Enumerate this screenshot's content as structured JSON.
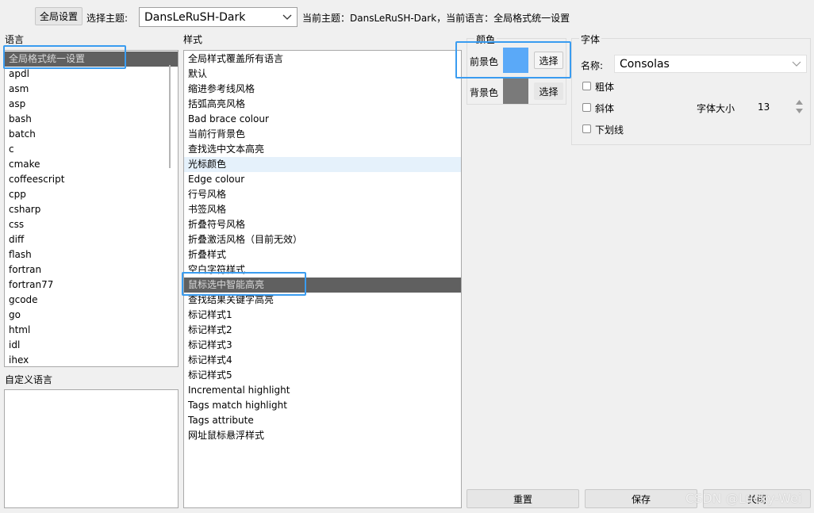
{
  "toolbar": {
    "global_settings_button": "全局设置",
    "select_theme_label": "选择主题:",
    "theme_value": "DansLeRuSH-Dark",
    "status_text": "当前主题：DansLeRuSH-Dark，当前语言：全局格式统一设置"
  },
  "language": {
    "label": "语言",
    "items": [
      "全局格式统一设置",
      "apdl",
      "asm",
      "asp",
      "bash",
      "batch",
      "c",
      "cmake",
      "coffeescript",
      "cpp",
      "csharp",
      "css",
      "diff",
      "flash",
      "fortran",
      "fortran77",
      "gcode",
      "go",
      "html",
      "idl",
      "ihex"
    ],
    "selected_index": 0
  },
  "custom_language": {
    "label": "自定义语言"
  },
  "style": {
    "label": "样式",
    "items": [
      "全局样式覆盖所有语言",
      "默认",
      "缩进参考线风格",
      "括弧高亮风格",
      "Bad brace colour",
      "当前行背景色",
      "查找选中文本高亮",
      "光标颜色",
      "Edge colour",
      "行号风格",
      "书签风格",
      "折叠符号风格",
      "折叠激活风格（目前无效）",
      "折叠样式",
      "空白字符样式",
      "鼠标选中智能高亮",
      "查找结果关键字高亮",
      "标记样式1",
      "标记样式2",
      "标记样式3",
      "标记样式4",
      "标记样式5",
      "Incremental highlight",
      "Tags match highlight",
      "Tags attribute",
      "网址鼠标悬浮样式"
    ],
    "selected_index": 15,
    "hover_index": 7
  },
  "color": {
    "label": "颜色",
    "foreground_label": "前景色",
    "foreground_color": "#5aa9f8",
    "background_label": "背景色",
    "background_color": "#7a7a7a",
    "choose_label": "选择"
  },
  "font": {
    "label": "字体",
    "name_label": "名称:",
    "name_value": "Consolas",
    "bold_label": "粗体",
    "italic_label": "斜体",
    "underline_label": "下划线",
    "size_label": "字体大小",
    "size_value": "13"
  },
  "footer": {
    "reset_label": "重置",
    "save_label": "保存",
    "close_label": "关闭",
    "watermark": "CSDN @Lucky-Wei"
  }
}
